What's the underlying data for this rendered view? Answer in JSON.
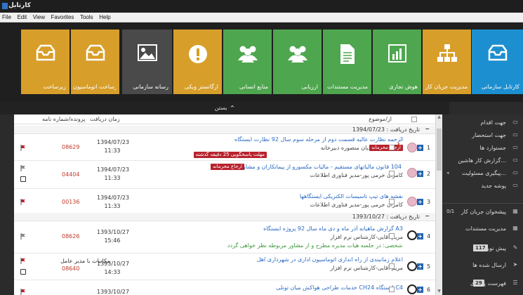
{
  "window": {
    "title": "کارتابل"
  },
  "menu": [
    "File",
    "Edit",
    "View",
    "Favorites",
    "Tools",
    "Help"
  ],
  "tiles": [
    {
      "label": "کارتابل سازمانی",
      "icon": "inbox-icon",
      "color": "#1c8fd0"
    },
    {
      "label": "مدیریت جریان کار",
      "icon": "org-chart-icon",
      "color": "#d89e2a"
    },
    {
      "label": "هوش تجاری",
      "icon": "bar-chart-icon",
      "color": "#4ea64f"
    },
    {
      "label": "مدیریت مستندات",
      "icon": "document-icon",
      "color": "#4ea64f"
    },
    {
      "label": "ارزیابی",
      "icon": "people-icon",
      "color": "#4ea64f"
    },
    {
      "label": "منابع انسانی",
      "icon": "people-icon",
      "color": "#4ea64f"
    },
    {
      "label": "ارگانستر ویکی",
      "icon": "exclamation-icon",
      "color": "#d89e2a"
    },
    {
      "label": "رسانه سازمانی",
      "icon": "image-icon",
      "color": "#4a4a4a"
    },
    {
      "label": "زیرساخت اتوماسیون",
      "icon": "tray-icon",
      "color": "#d89e2a"
    },
    {
      "label": "زیرساخت",
      "icon": "tray-icon",
      "color": "#d89e2a"
    }
  ],
  "collapse": {
    "label": "بستن"
  },
  "columns": {
    "subject": "از/موضوع",
    "received": "زمان دریافت",
    "case_no": "پرونده/شماره نامه"
  },
  "groups": [
    {
      "label": "تاریخ دریافت : 1394/07/23"
    },
    {
      "label": "تاریخ دریافت : 1393/10/27"
    }
  ],
  "rows": [
    {
      "no": "1",
      "subject": "حق الزحمه نظارت عالیه قسمت دوم از مرحله سوم سال 92 نظارت ایستگاه A3",
      "sender": "سعیدیان منصوره دبیرخانه",
      "badges": [
        "ارجاع محرمانه",
        "مهلت پاسخگویی 25 دقیقه گذشته"
      ],
      "number": "08629",
      "date": "1394/07/23",
      "time": "11:33"
    },
    {
      "no": "2",
      "subject": "اصلاحیه ماده 104 قانون مالیاتهای مستقیم - مالیات مکسورو از پیمانکاران و مشاوران",
      "sender": "کامران خرمی پور-مدیر فناوری اطلاعات",
      "badges": [
        "ارجاع محرمانه"
      ],
      "number": "04404",
      "date": "1394/07/23",
      "time": "11:33"
    },
    {
      "no": "3",
      "subject": "نقشه های تیپ تاسیسات الکتریکی ایستگاهها",
      "sender": "کامران خرمی پور-مدیر فناوری اطلاعات",
      "badges": [],
      "number": "00136",
      "date": "1394/07/23",
      "time": "11:33"
    },
    {
      "no": "4",
      "subject": "گزارش ماهیانه آذر ماه و دی ماه سال 92 پروژه ایستگاه A3",
      "sender": "مریم آقایی-کارشناس نرم افزار",
      "note": "یادداشت شخصی: در جلسه هیات مدیره مطرح و از مشاور مربوطه نظر خواهی گردد",
      "badges": [],
      "number": "08626",
      "date": "1393/10/27",
      "time": "15:46",
      "extra": ""
    },
    {
      "no": "5",
      "subject": "اعلام زمانبندی از راه اندازی اتوماسیون اداری در شهرداری اهل",
      "sender": "مریم آقایی-کارشناس نرم افزار",
      "badges": [],
      "number": "08640",
      "date": "1393/10/27",
      "time": "14:33",
      "extra": "مکاتبات با مدیر عامل"
    },
    {
      "no": "6",
      "subject": "خدمات طراحی هواکش میان تونلی CH24 ایستگاه C4",
      "sender": "",
      "badges": [],
      "number": "",
      "date": "1393/10/27",
      "time": "",
      "extra": ""
    }
  ],
  "sidebar": [
    {
      "label": "جهت اقدام",
      "icon": "folder-icon"
    },
    {
      "label": "جهت استحضار",
      "icon": "folder-icon"
    },
    {
      "label": "جستوارد ها",
      "icon": "folder-icon"
    },
    {
      "label": "گزارش کار هاشین...",
      "icon": "folder-icon"
    },
    {
      "label": "پیگیری مسئولیت...",
      "icon": "folder-icon"
    },
    {
      "label": "پوشه جدید",
      "icon": "folder-icon"
    },
    {
      "label": "پیشخوان جریان کار",
      "icon": "grid-icon",
      "count": "0/1"
    },
    {
      "label": "مدیریت مستندات",
      "icon": "grid-icon"
    },
    {
      "label": "پیش نویس",
      "icon": "pencil-icon",
      "count": "117"
    },
    {
      "label": "ارسال شده ها",
      "icon": "send-icon"
    },
    {
      "label": "فهرست پیگیری",
      "icon": "list-icon",
      "count": "29"
    }
  ]
}
